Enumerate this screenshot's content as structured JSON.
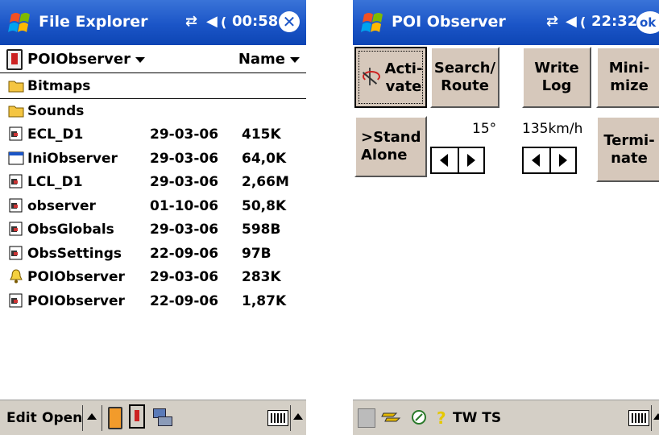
{
  "left": {
    "title": "File Explorer",
    "time": "00:58",
    "folder": "POIObserver",
    "sort": "Name",
    "files": [
      {
        "name": "Bitmaps",
        "date": "",
        "size": "",
        "icon": "folder-icon"
      },
      {
        "name": "Sounds",
        "date": "",
        "size": "",
        "icon": "folder-icon"
      },
      {
        "name": "ECL_D1",
        "date": "29-03-06",
        "size": "415K",
        "icon": "file-icon"
      },
      {
        "name": "IniObserver",
        "date": "29-03-06",
        "size": "64,0K",
        "icon": "window-file-icon"
      },
      {
        "name": "LCL_D1",
        "date": "29-03-06",
        "size": "2,66M",
        "icon": "file-icon"
      },
      {
        "name": "observer",
        "date": "01-10-06",
        "size": "50,8K",
        "icon": "file-icon"
      },
      {
        "name": "ObsGlobals",
        "date": "29-03-06",
        "size": "598B",
        "icon": "file-icon"
      },
      {
        "name": "ObsSettings",
        "date": "22-09-06",
        "size": "97B",
        "icon": "file-icon"
      },
      {
        "name": "POIObserver",
        "date": "29-03-06",
        "size": "283K",
        "icon": "bell-icon"
      },
      {
        "name": "POIObserver",
        "date": "22-09-06",
        "size": "1,87K",
        "icon": "file-icon"
      }
    ],
    "bottom": {
      "edit": "Edit",
      "open": "Open"
    }
  },
  "right": {
    "title": "POI Observer",
    "time": "22:32",
    "ok": "ok",
    "buttons": {
      "activate": [
        "Acti-",
        "vate"
      ],
      "search": [
        "Search/",
        "Route"
      ],
      "writelog": [
        "Write",
        "Log"
      ],
      "minimize": [
        "Mini-",
        "mize"
      ],
      "standalone": [
        ">Stand",
        "Alone"
      ],
      "terminate": [
        "Termi-",
        "nate"
      ]
    },
    "angle": "15°",
    "speed": "135km/h",
    "tray_text": "TW TS"
  },
  "colors": {
    "titlebar": "#1b55c7",
    "button": "#d6c8bb",
    "toolbar": "#d4cfc6"
  }
}
